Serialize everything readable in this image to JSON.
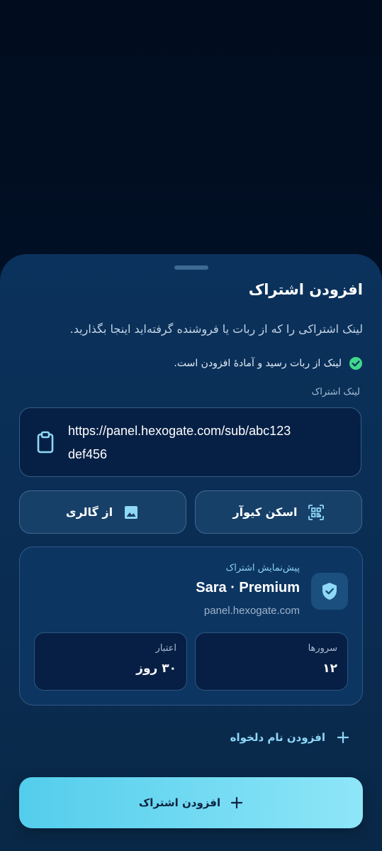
{
  "sheet": {
    "title": "افزودن اشتراک",
    "subtitle": "لینک اشتراکی را که از ربات یا فروشنده گرفته‌اید اینجا بگذارید.",
    "status_text": "لینک از ربات رسید و آمادهٔ افزودن است.",
    "field_label": "لینک اشتراک",
    "link_value": "https://panel.hexogate.com/sub/abc123def456"
  },
  "actions": {
    "scan_qr_label": "اسکن کیوآر",
    "gallery_label": "از گالری"
  },
  "preview": {
    "label": "پیش‌نمایش اشتراک",
    "name": "Sara · Premium",
    "host": "panel.hexogate.com",
    "servers_label": "سرورها",
    "servers_value": "۱۲",
    "validity_label": "اعتبار",
    "validity_value": "۳۰ روز"
  },
  "custom_name_label": "افزودن نام دلخواه",
  "primary_button_label": "افزودن اشتراک",
  "colors": {
    "accent": "#53cdec",
    "success": "#3fd98a",
    "sheet_bg": "#0b325c",
    "backdrop": "#010f24"
  },
  "icons": [
    "check-circle-icon",
    "clipboard-icon",
    "qr-scan-icon",
    "image-icon",
    "shield-check-icon",
    "plus-icon"
  ]
}
